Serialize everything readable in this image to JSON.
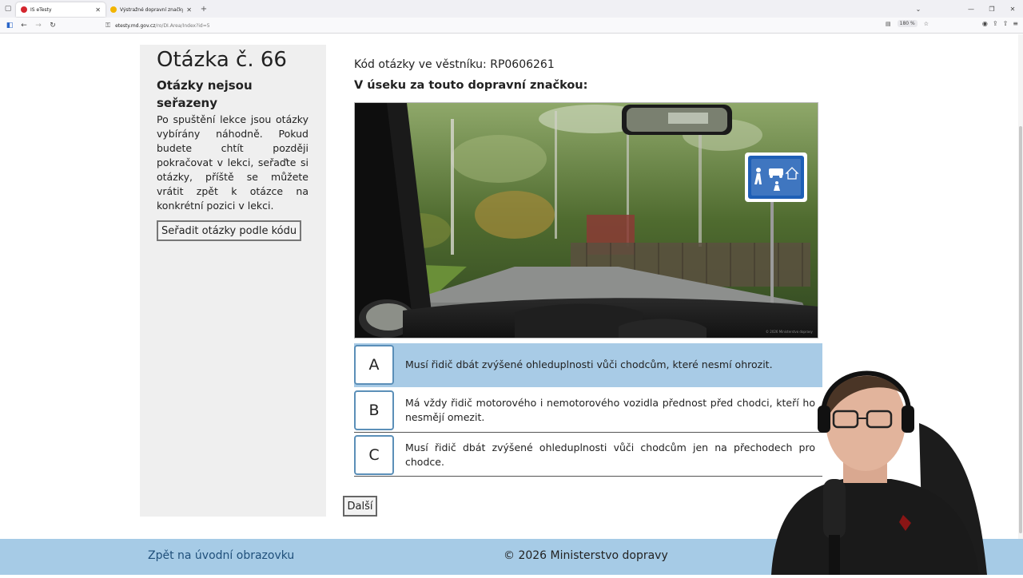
{
  "browser": {
    "tabs": [
      {
        "title": "IS eTesty",
        "active": true,
        "favicon_color": "#d4262e"
      },
      {
        "title": "Výstražné dopravní značky",
        "active": false,
        "favicon_color": "#f2b400"
      }
    ],
    "url_host": "etesty.md.gov.cz",
    "url_path": "/ro/DI.Area/Index?id=5",
    "zoom": "180 %"
  },
  "sidebar": {
    "question_title": "Otázka č. 66",
    "sort_heading": "Otázky nejsou seřazeny",
    "sort_description": "Po spuštění lekce jsou otázky vybírány náhodně. Pokud budete chtít později pokračovat v lekci, seřaďte si otázky, příště se můžete vrátit zpět k otázce na konkrétní pozici v lekci.",
    "sort_button": "Seřadit otázky podle kódu"
  },
  "question": {
    "code_label": "Kód otázky ve věstníku: RP0606261",
    "text": "V úseku za touto dopravní značkou:",
    "photo_watermark": "© 2026 Ministerstvo dopravy"
  },
  "answers": [
    {
      "letter": "A",
      "text": "Musí řidič dbát zvýšené ohleduplnosti vůči chodcům, které nesmí ohrozit.",
      "highlighted": true
    },
    {
      "letter": "B",
      "text": "Má vždy řidič motorového i nemotorového vozidla přednost před chodci, kteří ho nesmějí omezit.",
      "highlighted": false
    },
    {
      "letter": "C",
      "text": "Musí řidič dbát zvýšené ohleduplnosti vůči chodcům jen na přechodech pro chodce.",
      "highlighted": false
    }
  ],
  "next_button": "Další",
  "footer": {
    "back_link": "Zpět na úvodní obrazovku",
    "copyright": "© 2026 Ministerstvo dopravy"
  },
  "colors": {
    "footer_bg": "#a6cbe6",
    "highlight_bg": "#a8cbe6",
    "letter_border": "#5b8fb8",
    "sidebar_bg": "#efefef"
  }
}
